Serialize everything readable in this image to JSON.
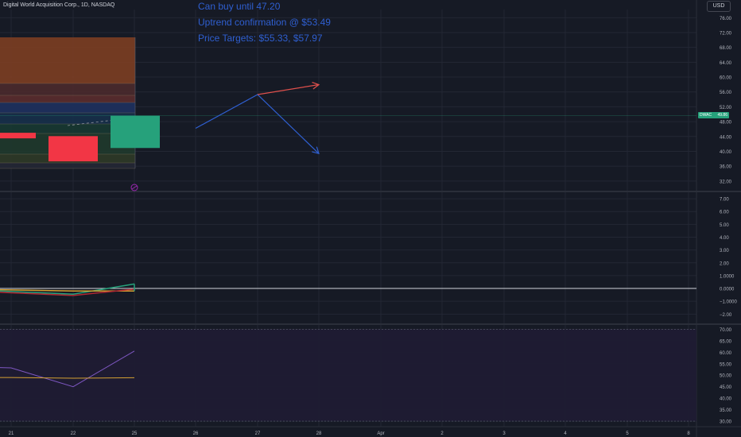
{
  "header": {
    "title": "Digital World Acquisition Corp., 1D, NASDAQ",
    "currency_button": "USD"
  },
  "annotations": [
    "Can buy until 47.20",
    "Uptrend confirmation @ $53.49",
    "Price Targets: $55.33, $57.97"
  ],
  "price_label": {
    "symbol": "DWAC",
    "value": "49.86"
  },
  "colors": {
    "background": "#161a25",
    "grid": "#232734",
    "up": "#26a17b",
    "down": "#f23645",
    "annotation_blue": "#2f5fd0",
    "arrow_red": "#e0504c",
    "axis_text": "#b2b5be"
  },
  "chart_data": [
    {
      "type": "candlestick",
      "title": "Digital World Acquisition Corp., 1D, NASDAQ",
      "x_ticks": [
        "21",
        "22",
        "25",
        "26",
        "27",
        "28",
        "Apr",
        "2",
        "3",
        "4",
        "5",
        "8"
      ],
      "y_ticks": [
        32,
        36,
        40,
        44,
        48,
        52,
        56,
        60,
        64,
        68,
        72,
        76
      ],
      "ylim": [
        29.4,
        78.2
      ],
      "candles": [
        {
          "x": "21",
          "open": 45,
          "close": 43.5,
          "high": 45,
          "low": 43.5,
          "direction": "down"
        },
        {
          "x": "22",
          "open": 44.1,
          "close": 37.3,
          "high": 44.1,
          "low": 37.3,
          "direction": "down"
        },
        {
          "x": "25",
          "open": 40.9,
          "close": 49.6,
          "high": 49.6,
          "low": 40.9,
          "direction": "up"
        }
      ],
      "last_price": 49.86,
      "projection": [
        {
          "x": "26",
          "y": 46.2
        },
        {
          "x": "27",
          "y": 55.3
        },
        {
          "x": "28",
          "y": 39.4
        }
      ],
      "target_arrow": [
        {
          "x": "27",
          "y": 55.3
        },
        {
          "x": "28",
          "y": 57.97
        }
      ]
    },
    {
      "type": "line",
      "title": "",
      "y_ticks": [
        7.0,
        6.0,
        5.0,
        4.0,
        3.0,
        2.0,
        1.0,
        0.0,
        -1.0,
        -2.0
      ],
      "y_tick_labels": [
        "7.00",
        "6.00",
        "5.00",
        "4.00",
        "3.00",
        "2.00",
        "1.0000",
        "0.0000",
        "−1.0000",
        "−2.00"
      ],
      "ylim": [
        -2.6,
        7.5
      ],
      "zero_line": 0,
      "series": [
        {
          "color": "#26a17b",
          "x": [
            "21",
            "22",
            "25"
          ],
          "values": [
            -0.2,
            -0.45,
            0.35
          ]
        },
        {
          "color": "#d4a032",
          "x": [
            "21",
            "22",
            "25"
          ],
          "values": [
            -0.1,
            -0.2,
            -0.2
          ]
        },
        {
          "color": "#b22833",
          "x": [
            "21",
            "22",
            "25"
          ],
          "values": [
            -0.3,
            -0.55,
            -0.05
          ]
        }
      ]
    },
    {
      "type": "line",
      "title": "",
      "y_ticks": [
        30,
        35,
        40,
        45,
        50,
        55,
        60,
        65,
        70
      ],
      "ylim": [
        29,
        71.5
      ],
      "band": [
        30,
        70
      ],
      "series": [
        {
          "color": "#7e57c2",
          "x": [
            "20",
            "21",
            "22",
            "25"
          ],
          "values": [
            53.5,
            53.2,
            45,
            60.5
          ]
        },
        {
          "color": "#d4a032",
          "x": [
            "20",
            "21",
            "22",
            "25"
          ],
          "values": [
            49,
            49,
            48.7,
            48.9
          ]
        }
      ]
    }
  ]
}
